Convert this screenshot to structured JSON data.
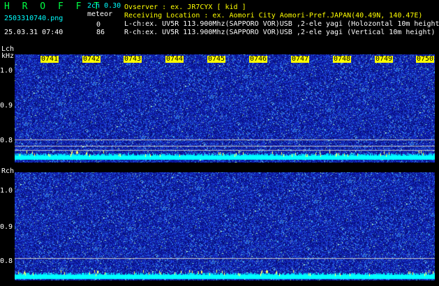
{
  "header": {
    "app_title": "H R O F F T",
    "version": "2ch 0.30",
    "meteor_label": "meteor",
    "filename": "2503310740.png",
    "count_l": "0",
    "count_r": "86",
    "datetime": "25.03.31 07:40",
    "observer": "Ovserver           : ex. JR7CYX [ kid ]",
    "location": "Receiving Location : ex. Aomori City Aomori-Pref.JAPAN(40.49N, 140.47E)",
    "lch_info": "L-ch:ex. UV5R 113.900Mhz(SAPPORO VOR)USB ,2-ele yagi (Holozontal 10m height)",
    "rch_info": "R-ch:ex. UV5R 113.900Mhz(SAPPORO VOR)USB ,2-ele yagi (Vertical 10m height)"
  },
  "lch": {
    "label": "Lch",
    "unit": "kHz",
    "yticks": [
      "1.0",
      "0.9",
      "0.8"
    ]
  },
  "rch": {
    "label": "Rch",
    "yticks": [
      "1.0",
      "0.9",
      "0.8"
    ]
  },
  "time_labels": [
    "0741",
    "0742",
    "0743",
    "0744",
    "0745",
    "0746",
    "0747",
    "0748",
    "0749",
    "0750"
  ],
  "colors": {
    "background": "#000000",
    "spectrogram_base": "#10209a",
    "noise_band": "#00ffff",
    "title": "#00ff44",
    "time_label_bg": "#ffff00"
  }
}
